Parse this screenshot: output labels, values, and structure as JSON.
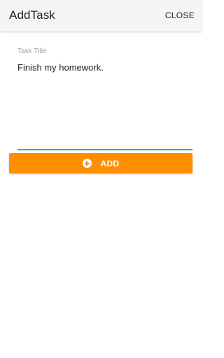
{
  "appbar": {
    "title": "AddTask",
    "close_label": "CLOSE"
  },
  "form": {
    "title_label": "Task Title",
    "title_value": "Finish my homework.",
    "underline_color": "#4caf50"
  },
  "add_button": {
    "label": "ADD",
    "icon": "add-circle-icon",
    "color": "#ff8f00"
  }
}
